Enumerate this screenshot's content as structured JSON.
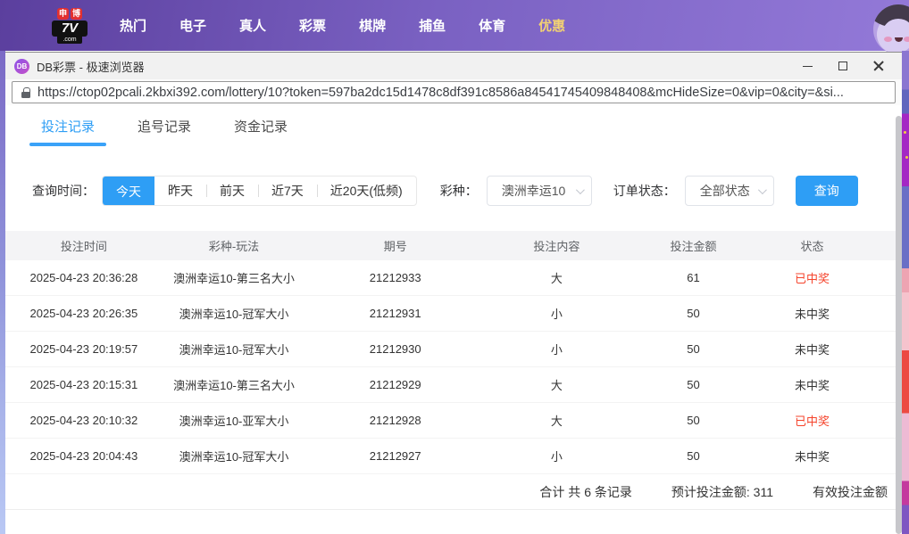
{
  "site_nav": {
    "logo": {
      "badge1": "申",
      "badge2": "博",
      "brand": "7V",
      "suffix": ".com"
    },
    "items": [
      {
        "label": "热门"
      },
      {
        "label": "电子"
      },
      {
        "label": "真人"
      },
      {
        "label": "彩票"
      },
      {
        "label": "棋牌"
      },
      {
        "label": "捕鱼"
      },
      {
        "label": "体育"
      },
      {
        "label": "优惠",
        "highlight": true
      }
    ]
  },
  "browser": {
    "tab_icon_text": "DB",
    "window_title": "DB彩票 - 极速浏览器",
    "url": "https://ctop02pcali.2kbxi392.com/lottery/10?token=597ba2dc15d1478c8df391c8586a84541745409848408&mcHideSize=0&vip=0&city=&si..."
  },
  "tabs": [
    {
      "label": "投注记录",
      "active": true
    },
    {
      "label": "追号记录"
    },
    {
      "label": "资金记录"
    }
  ],
  "filters": {
    "time_label": "查询时间：",
    "time_options": [
      {
        "label": "今天",
        "active": true
      },
      {
        "label": "昨天"
      },
      {
        "label": "前天"
      },
      {
        "label": "近7天"
      },
      {
        "label": "近20天(低频)"
      }
    ],
    "lottery_label": "彩种：",
    "lottery_value": "澳洲幸运10",
    "status_label": "订单状态：",
    "status_value": "全部状态",
    "search_button": "查询"
  },
  "table": {
    "columns": [
      "投注时间",
      "彩种-玩法",
      "期号",
      "投注内容",
      "投注金额",
      "状态"
    ],
    "rows": [
      {
        "time": "2025-04-23 20:36:28",
        "play": "澳洲幸运10-第三名大小",
        "period": "21212933",
        "content": "大",
        "amount": "61",
        "status": "已中奖",
        "won": true
      },
      {
        "time": "2025-04-23 20:26:35",
        "play": "澳洲幸运10-冠军大小",
        "period": "21212931",
        "content": "小",
        "amount": "50",
        "status": "未中奖",
        "won": false
      },
      {
        "time": "2025-04-23 20:19:57",
        "play": "澳洲幸运10-冠军大小",
        "period": "21212930",
        "content": "小",
        "amount": "50",
        "status": "未中奖",
        "won": false
      },
      {
        "time": "2025-04-23 20:15:31",
        "play": "澳洲幸运10-第三名大小",
        "period": "21212929",
        "content": "大",
        "amount": "50",
        "status": "未中奖",
        "won": false
      },
      {
        "time": "2025-04-23 20:10:32",
        "play": "澳洲幸运10-亚军大小",
        "period": "21212928",
        "content": "大",
        "amount": "50",
        "status": "已中奖",
        "won": true
      },
      {
        "time": "2025-04-23 20:04:43",
        "play": "澳洲幸运10-冠军大小",
        "period": "21212927",
        "content": "小",
        "amount": "50",
        "status": "未中奖",
        "won": false
      }
    ]
  },
  "summary": {
    "total": "合计 共 6 条记录",
    "expected": "预计投注金额: 311",
    "valid": "有效投注金额"
  },
  "colors": {
    "accent_blue": "#2e9ef5",
    "win_red": "#f5432b",
    "nav_purple_dark": "#5b3f9e",
    "nav_purple_light": "#9379d8",
    "promo_yellow": "#f2d173"
  }
}
